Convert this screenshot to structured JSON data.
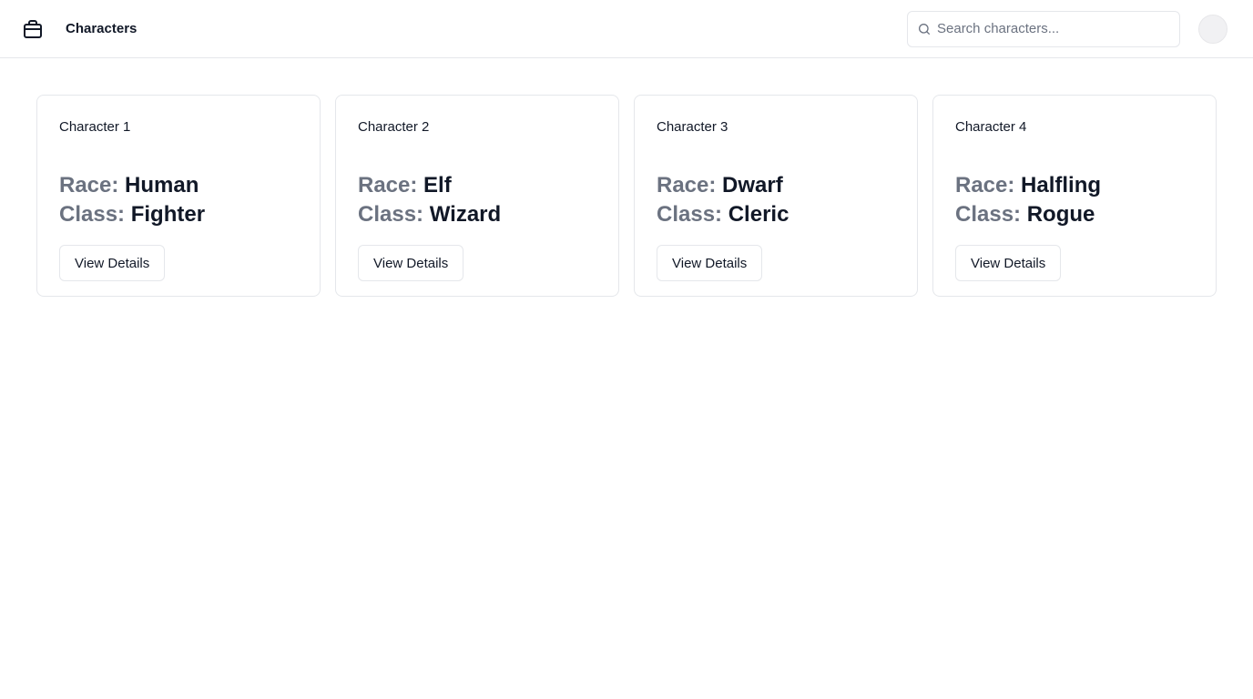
{
  "header": {
    "logo_icon": "package-icon",
    "title": "Characters",
    "search": {
      "placeholder": "Search characters...",
      "value": "",
      "icon": "search-icon"
    },
    "avatar": ""
  },
  "labels": {
    "race": "Race:",
    "class": "Class:"
  },
  "cards": [
    {
      "title": "Character 1",
      "race": "Human",
      "class": "Fighter",
      "button": "View Details"
    },
    {
      "title": "Character 2",
      "race": "Elf",
      "class": "Wizard",
      "button": "View Details"
    },
    {
      "title": "Character 3",
      "race": "Dwarf",
      "class": "Cleric",
      "button": "View Details"
    },
    {
      "title": "Character 4",
      "race": "Halfling",
      "class": "Rogue",
      "button": "View Details"
    }
  ],
  "colors": {
    "text": "#111827",
    "muted": "#6b7280",
    "border": "#e5e7eb",
    "background": "#ffffff"
  }
}
